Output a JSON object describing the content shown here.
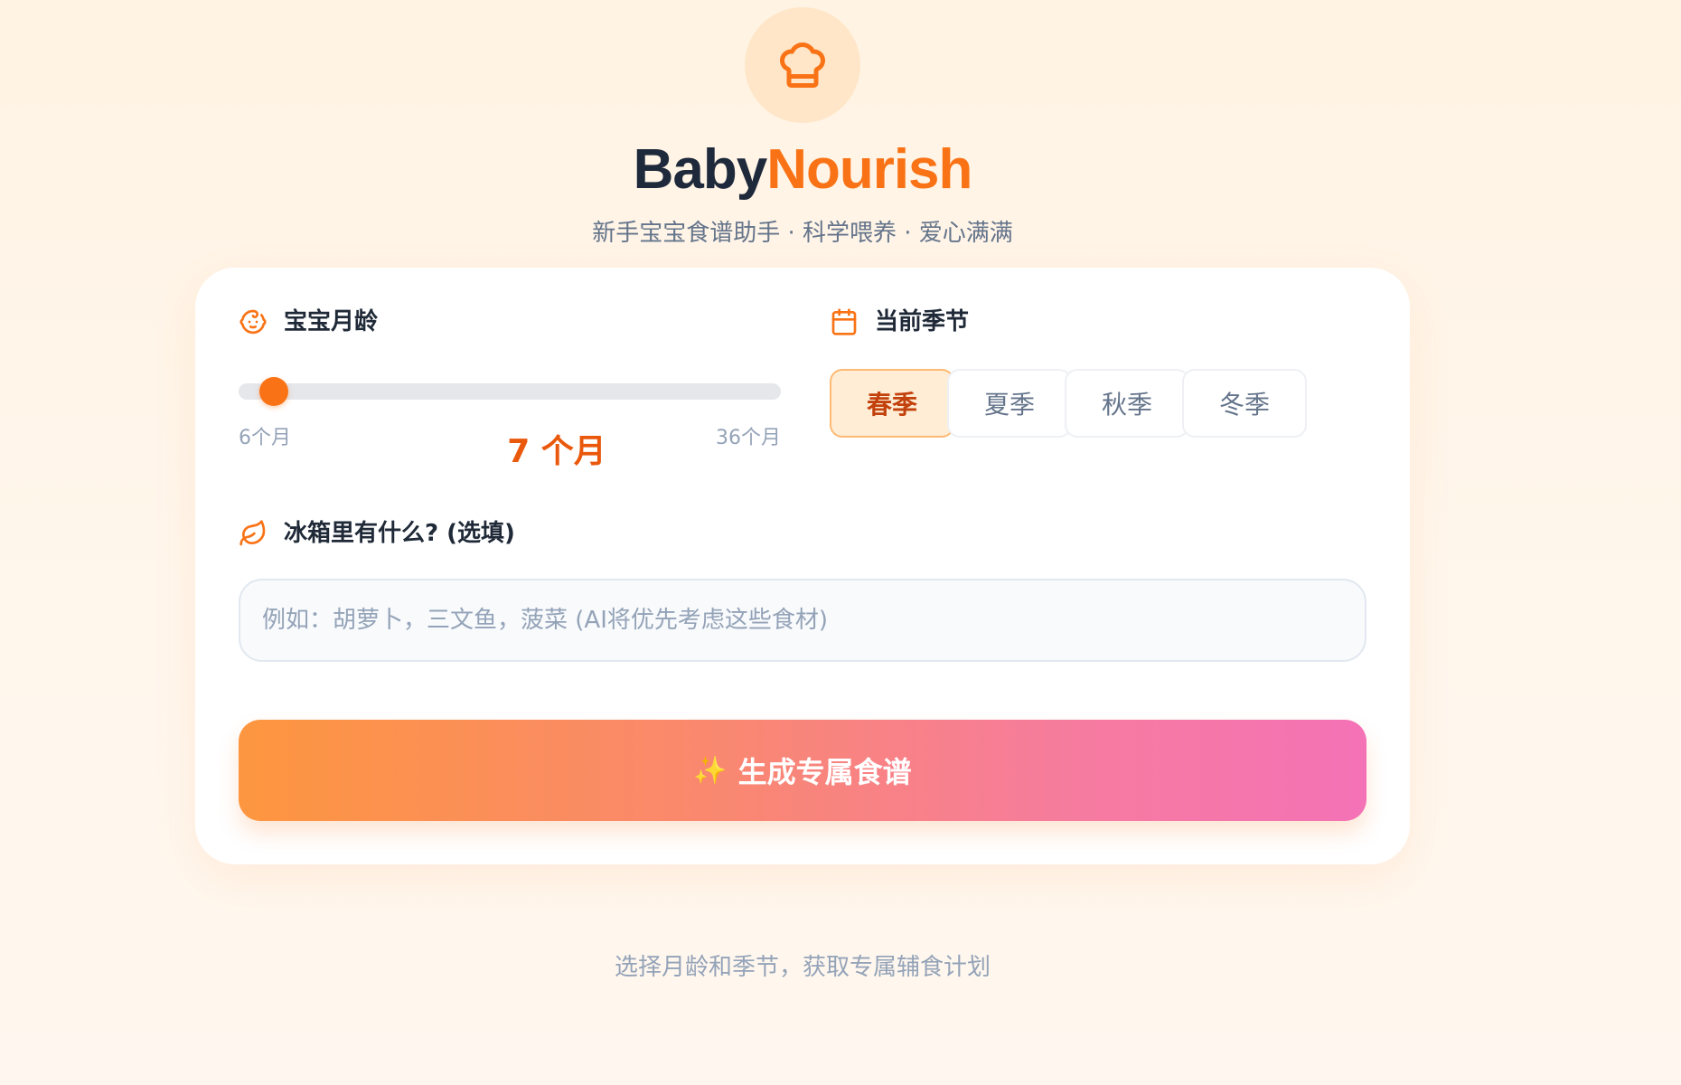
{
  "app": {
    "brand_part1": "Baby",
    "brand_part2": "Nourish",
    "subtitle": "新手宝宝食谱助手 · 科学喂养 · 爱心满满",
    "logo_icon": "chef-hat-icon"
  },
  "age": {
    "label": "宝宝月龄",
    "icon": "baby-face-icon",
    "min_label": "6个月",
    "max_label": "36个月",
    "min": 6,
    "max": 36,
    "value": 7,
    "value_text": "7 个月"
  },
  "season": {
    "label": "当前季节",
    "icon": "calendar-icon",
    "options": [
      "春季",
      "夏季",
      "秋季",
      "冬季"
    ],
    "selected": "春季"
  },
  "fridge": {
    "label": "冰箱里有什么? (选填)",
    "icon": "leaf-icon",
    "value": "",
    "placeholder": "例如：胡萝卜，三文鱼，菠菜 (AI将优先考虑这些食材)"
  },
  "generate": {
    "icon": "sparkles-icon",
    "label": "生成专属食谱"
  },
  "footer": {
    "hint": "选择月龄和季节，获取专属辅食计划"
  },
  "colors": {
    "accent": "#f97316",
    "accent_dark": "#ea580c",
    "gradient_start": "#fd963f",
    "gradient_end": "#f472b6"
  }
}
